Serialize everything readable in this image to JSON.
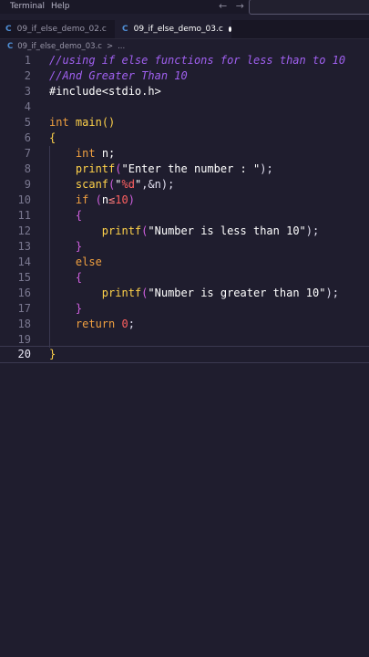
{
  "menu": {
    "terminal": "Terminal",
    "help": "Help"
  },
  "nav": {
    "back": "←",
    "forward": "→"
  },
  "tabs": [
    {
      "label": "09_if_else_demo_02.c",
      "icon": "C"
    },
    {
      "label": "09_if_else_demo_03.c",
      "icon": "C"
    }
  ],
  "breadcrumb": {
    "file": "09_if_else_demo_03.c",
    "sep": ">",
    "more": "..."
  },
  "editor": {
    "line_numbers": [
      "1",
      "2",
      "3",
      "4",
      "5",
      "6",
      "7",
      "8",
      "9",
      "10",
      "11",
      "12",
      "13",
      "14",
      "15",
      "16",
      "17",
      "18",
      "19",
      "20"
    ],
    "current_line": "20",
    "lines": {
      "l1": "//using if else functions for less than to 10",
      "l2": "//And Greater Than 10",
      "l3_inc": "#include",
      "l3_hdr": "<stdio.h>",
      "l5_kw": "int",
      "l5_fn": "main",
      "l5_paren": "()",
      "l6": "{",
      "l7_kw": "int",
      "l7_rest": " n;",
      "l8_fn": "printf",
      "l8_open": "(",
      "l8_str": "\"Enter the number : \"",
      "l8_close": ");",
      "l9_fn": "scanf",
      "l9_open": "(",
      "l9_q1": "\"",
      "l9_fmt": "%d",
      "l9_q2": "\"",
      "l9_rest": ",&n);",
      "l10_kw": "if",
      "l10_open": " (",
      "l10_var": "n",
      "l10_op": "≤",
      "l10_num": "10",
      "l11": "{",
      "l12_fn": "printf",
      "l12_open": "(",
      "l12_str": "\"Number is less than 10\"",
      "l12_close": ");",
      "l13": "}",
      "l14_kw": "else",
      "l15": "{",
      "l16_fn": "printf",
      "l16_open": "(",
      "l16_str": "\"Number is greater than 10\"",
      "l16_close": ");",
      "l17": "}",
      "l18_kw": "return",
      "l18_num": "0",
      "l18_rest": ";",
      "l20": "}"
    }
  }
}
